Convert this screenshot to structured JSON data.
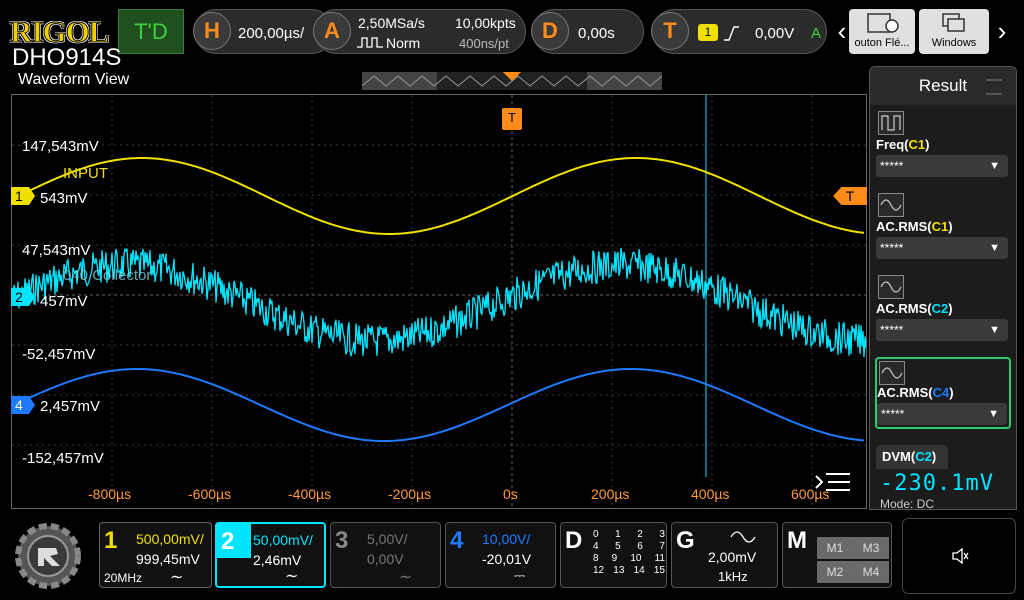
{
  "brand": {
    "logo": "RIGOL",
    "model": "DHO914S"
  },
  "view_title": "Waveform View",
  "topbar": {
    "td_label": "T'D",
    "horizontal": {
      "letter": "H",
      "value": "200,00µs/"
    },
    "acquire": {
      "letter": "A",
      "sample_rate": "2,50MSa/s",
      "mode": "Norm",
      "points": "10,00kpts",
      "per_point": "400ns/pt"
    },
    "delay": {
      "letter": "D",
      "value": "0,00s"
    },
    "trigger": {
      "letter": "T",
      "source": "1",
      "level": "0,00V",
      "status": "A"
    },
    "apps": [
      {
        "label": "outon Flé..."
      },
      {
        "label": "Windows"
      }
    ],
    "nav_left": "‹",
    "nav_right": "›"
  },
  "waveform": {
    "trigger_marker": "T",
    "level_marker": "T",
    "offsets": [
      "147,543mV",
      "47,543mV",
      "-52,457mV",
      "-152,457mV"
    ],
    "ch1_label": "INPUT",
    "ch2_label": "040 Collector",
    "ch1_marker": {
      "num": "1",
      "value": "543mV"
    },
    "ch2_marker": {
      "num": "2",
      "value": "457mV"
    },
    "ch4_marker": {
      "num": "4",
      "value": "2,457mV"
    },
    "time_labels": [
      "-800µs",
      "-600µs",
      "-400µs",
      "-200µs",
      "0s",
      "200µs",
      "400µs",
      "600µs"
    ]
  },
  "result_panel": {
    "title": "Result",
    "measurements": [
      {
        "name": "Freq",
        "ch": "C1",
        "value": "*****",
        "color": "#f0e000"
      },
      {
        "name": "AC.RMS",
        "ch": "C1",
        "value": "*****",
        "color": "#f0e000"
      },
      {
        "name": "AC.RMS",
        "ch": "C2",
        "value": "*****",
        "color": "#00e5ff"
      },
      {
        "name": "AC.RMS",
        "ch": "C4",
        "value": "*****",
        "color": "#1e7bff"
      }
    ],
    "dvm": {
      "name": "DVM",
      "ch": "C2",
      "value": "-230.1mV",
      "mode": "Mode: DC"
    }
  },
  "channels": [
    {
      "num": "1",
      "scale": "500,00mV/",
      "offset": "999,45mV",
      "bw": "20MHz",
      "coupling": "∼",
      "color": "#f0e000"
    },
    {
      "num": "2",
      "scale": "50,00mV/",
      "offset": "2,46mV",
      "coupling": "∼",
      "color": "#00e5ff"
    },
    {
      "num": "3",
      "scale": "5,00V/",
      "offset": "0,00V",
      "coupling": "∼",
      "color": "#777777"
    },
    {
      "num": "4",
      "scale": "10,00V/",
      "offset": "-20,01V",
      "coupling": "⎓",
      "color": "#1e7bff"
    }
  ],
  "digital": {
    "letter": "D",
    "rows": [
      [
        "0",
        "1",
        "2",
        "3"
      ],
      [
        "4",
        "5",
        "6",
        "7"
      ],
      [
        "8",
        "9",
        "10",
        "11"
      ],
      [
        "12",
        "13",
        "14",
        "15"
      ]
    ]
  },
  "generator": {
    "letter": "G",
    "amplitude": "2,00mV",
    "freq": "1kHz"
  },
  "math": {
    "letter": "M",
    "buttons": [
      "M1",
      "M3",
      "M2",
      "M4"
    ]
  }
}
